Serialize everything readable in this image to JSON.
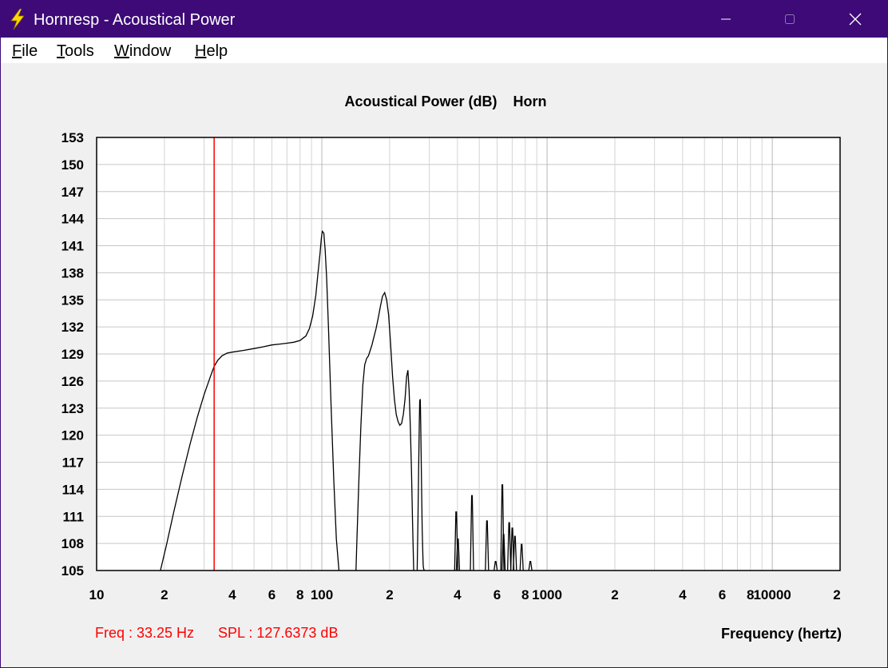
{
  "window": {
    "title": "Hornresp - Acoustical Power",
    "titlebar_color": "#3d0a78"
  },
  "menu": {
    "file_first": "F",
    "file_rest": "ile",
    "tools_first": "T",
    "tools_rest": "ools",
    "window_first": "W",
    "window_rest": "indow",
    "help_first": "H",
    "help_rest": "elp"
  },
  "status": {
    "freq_text": "Freq : 33.25 Hz",
    "spl_text": "SPL : 127.6373 dB",
    "color": "#ff0000"
  },
  "chart_data": {
    "type": "line",
    "title": "Acoustical Power (dB)    Horn",
    "xlabel": "Frequency (hertz)",
    "ylabel": "",
    "x_scale": "log",
    "xlim": [
      10,
      20000
    ],
    "ylim": [
      105,
      153
    ],
    "grid": true,
    "line_color": "#000000",
    "cursor_color": "#ff0000",
    "cursor_x": 33.25,
    "y_ticks": [
      153,
      150,
      147,
      144,
      141,
      138,
      135,
      132,
      129,
      126,
      123,
      120,
      117,
      114,
      111,
      108,
      105
    ],
    "x_tick_labels": [
      {
        "value": 10,
        "label": "10"
      },
      {
        "value": 20,
        "label": "2"
      },
      {
        "value": 40,
        "label": "4"
      },
      {
        "value": 60,
        "label": "6"
      },
      {
        "value": 80,
        "label": "8"
      },
      {
        "value": 100,
        "label": "100"
      },
      {
        "value": 200,
        "label": "2"
      },
      {
        "value": 400,
        "label": "4"
      },
      {
        "value": 600,
        "label": "6"
      },
      {
        "value": 800,
        "label": "8"
      },
      {
        "value": 1000,
        "label": "1000"
      },
      {
        "value": 2000,
        "label": "2"
      },
      {
        "value": 4000,
        "label": "4"
      },
      {
        "value": 6000,
        "label": "6"
      },
      {
        "value": 8000,
        "label": "8"
      },
      {
        "value": 10000,
        "label": "10000"
      },
      {
        "value": 20000,
        "label": "2"
      }
    ],
    "series": [
      {
        "x": [
          19.2,
          20.5,
          22,
          24,
          26,
          28,
          30,
          32,
          33.25,
          34.5,
          36,
          38,
          40,
          45,
          50,
          55,
          60,
          65,
          70,
          75,
          80,
          85,
          88,
          91,
          94,
          96,
          98,
          99.5,
          100.5,
          102,
          103.5,
          105,
          107,
          110,
          113,
          116,
          120,
          124,
          128,
          131,
          133,
          135,
          137,
          139,
          141,
          143,
          146,
          149,
          152,
          155,
          158,
          161,
          164,
          167,
          170,
          174,
          178,
          182,
          186,
          190,
          194,
          198,
          202,
          206,
          210,
          214,
          218,
          222,
          226,
          230,
          234,
          238,
          241,
          244,
          247,
          250,
          253,
          256,
          259,
          261,
          263,
          265,
          267,
          269,
          271,
          272,
          273.5,
          275,
          277,
          279,
          281,
          282,
          283,
          284,
          285
        ],
        "y": [
          105,
          108,
          111.5,
          115.5,
          119,
          122,
          124.5,
          126.5,
          127.64,
          128.3,
          128.8,
          129.1,
          129.2,
          129.4,
          129.6,
          129.8,
          130.0,
          130.1,
          130.2,
          130.3,
          130.5,
          131.0,
          131.8,
          133.2,
          135.5,
          137.8,
          140.0,
          141.8,
          142.6,
          142.4,
          140.5,
          137.5,
          132.0,
          123.0,
          115.0,
          108.5,
          104.0,
          100.0,
          96.0,
          94.0,
          93.5,
          94.0,
          96.0,
          99.0,
          103.0,
          108.0,
          115.0,
          121.0,
          125.5,
          127.8,
          128.5,
          128.8,
          129.4,
          130.0,
          130.8,
          131.8,
          133.0,
          134.3,
          135.4,
          135.8,
          135.0,
          133.3,
          130.0,
          126.5,
          124.0,
          122.3,
          121.5,
          121.1,
          121.3,
          122.3,
          124.0,
          126.5,
          127.2,
          125.0,
          121.0,
          116.0,
          110.0,
          104.5,
          101.0,
          100.0,
          101.5,
          105.0,
          110.0,
          116.0,
          121.5,
          123.8,
          124.0,
          121.0,
          115.0,
          109.5,
          106.5,
          105.5,
          105.2,
          105.1,
          105.0
        ]
      }
    ],
    "spikes": [
      {
        "x": 395,
        "y": 111.5
      },
      {
        "x": 402,
        "y": 108.5
      },
      {
        "x": 464,
        "y": 113.3
      },
      {
        "x": 541,
        "y": 110.5
      },
      {
        "x": 591,
        "y": 106.0
      },
      {
        "x": 633,
        "y": 114.5
      },
      {
        "x": 641,
        "y": 109.0
      },
      {
        "x": 679,
        "y": 110.3
      },
      {
        "x": 701,
        "y": 109.7
      },
      {
        "x": 720,
        "y": 108.8
      },
      {
        "x": 771,
        "y": 107.9
      },
      {
        "x": 843,
        "y": 106.0
      }
    ]
  }
}
